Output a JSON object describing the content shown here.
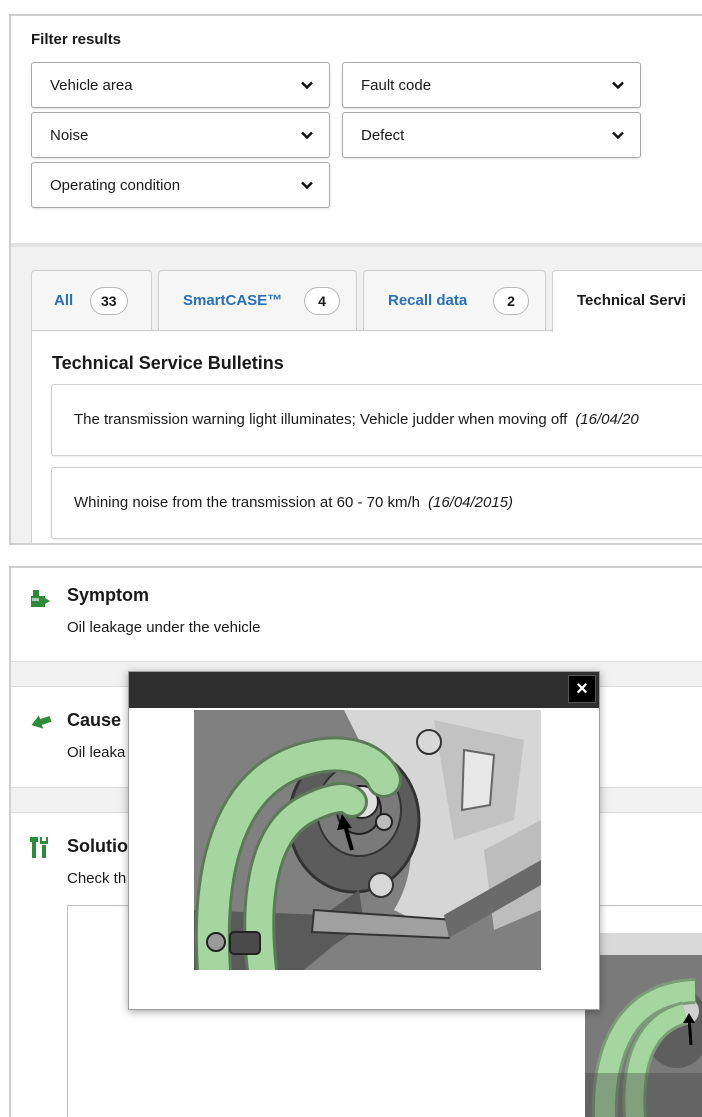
{
  "filters": {
    "title": "Filter results",
    "dropdowns": [
      {
        "label": "Vehicle area"
      },
      {
        "label": "Fault code"
      },
      {
        "label": "Noise"
      },
      {
        "label": "Defect"
      },
      {
        "label": "Operating condition"
      }
    ]
  },
  "tabs": [
    {
      "label": "All",
      "count": "33"
    },
    {
      "label": "SmartCASE™",
      "count": "4"
    },
    {
      "label": "Recall data",
      "count": "2"
    },
    {
      "label": "Technical Servi"
    }
  ],
  "bulletins": {
    "heading": "Technical Service Bulletins",
    "items": [
      {
        "text": "The transmission warning light illuminates; Vehicle judder when moving off",
        "date": "(16/04/20"
      },
      {
        "text": "Whining noise from the transmission at 60 - 70 km/h",
        "date": "(16/04/2015)"
      }
    ]
  },
  "detail": {
    "symptom": {
      "title": "Symptom",
      "text": "Oil leakage under the vehicle"
    },
    "cause": {
      "title": "Cause",
      "text": "Oil leaka"
    },
    "solution": {
      "title": "Solutio",
      "text": "Check th"
    }
  },
  "modal": {
    "close_label": "×"
  },
  "colors": {
    "accent_green": "#2e8b3a",
    "link_blue": "#2a6fb8",
    "hose_green": "#a6d6a0"
  }
}
